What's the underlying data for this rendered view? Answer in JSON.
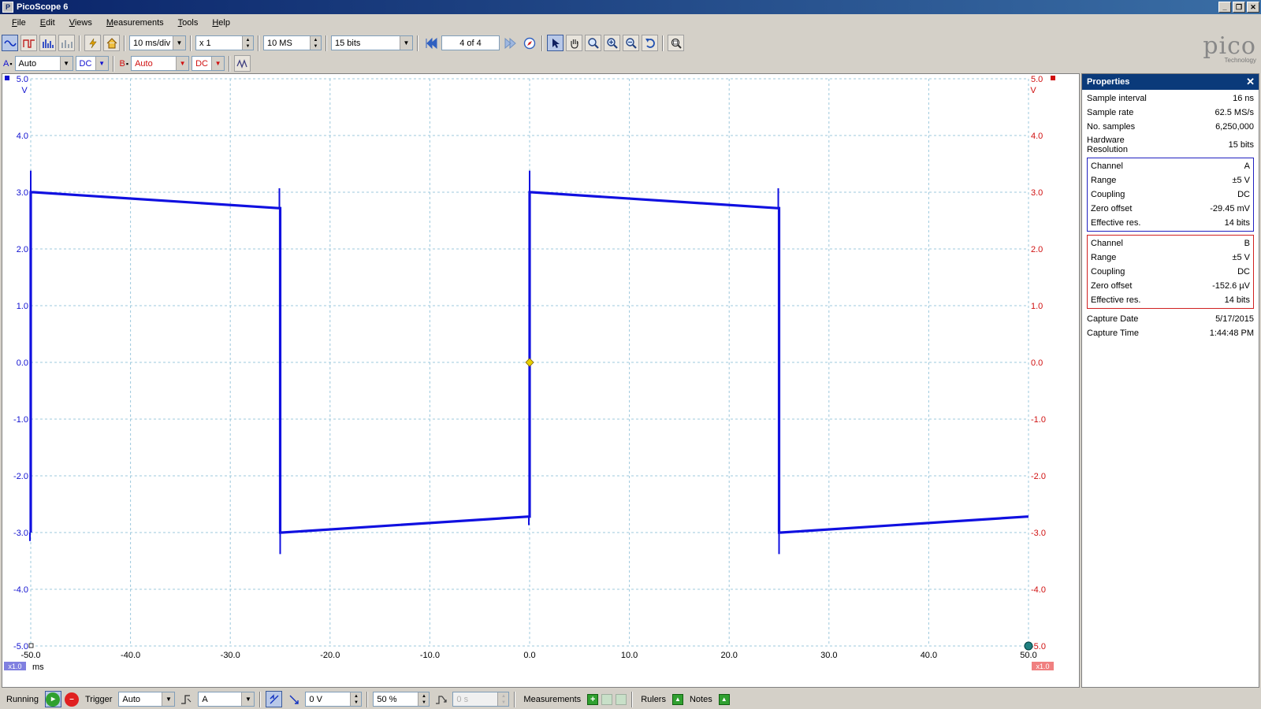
{
  "window": {
    "title": "PicoScope 6"
  },
  "menu": [
    {
      "label": "File",
      "key": "F",
      "rest": "ile"
    },
    {
      "label": "Edit",
      "key": "E",
      "rest": "dit"
    },
    {
      "label": "Views",
      "key": "V",
      "rest": "iews"
    },
    {
      "label": "Measurements",
      "key": "M",
      "rest": "easurements"
    },
    {
      "label": "Tools",
      "key": "T",
      "rest": "ools"
    },
    {
      "label": "Help",
      "key": "H",
      "rest": "elp"
    }
  ],
  "toolbar": {
    "timebase": "10 ms/div",
    "zoom": "x 1",
    "samples": "10 MS",
    "resolution": "15 bits",
    "buffer": "4 of 4"
  },
  "channels": {
    "a": {
      "label": "A",
      "range": "Auto",
      "coupling": "DC",
      "color": "#1010d0"
    },
    "b": {
      "label": "B",
      "range": "Auto",
      "coupling": "DC",
      "color": "#d01010"
    }
  },
  "logo": {
    "main": "pico",
    "sub": "Technology"
  },
  "scope": {
    "x_unit": "ms",
    "left_unit": "V",
    "right_unit": "V",
    "x_ticks": [
      "-50.0",
      "-40.0",
      "-30.0",
      "-20.0",
      "-10.0",
      "0.0",
      "10.0",
      "20.0",
      "30.0",
      "40.0",
      "50.0"
    ],
    "y_ticks": [
      "5.0",
      "4.0",
      "3.0",
      "2.0",
      "1.0",
      "0.0",
      "-1.0",
      "-2.0",
      "-3.0",
      "-4.0",
      "-5.0"
    ],
    "left_scale_badge": "x1.0",
    "right_scale_badge": "x1.0",
    "trigger_color": "#e8d000"
  },
  "chart_data": {
    "type": "line",
    "xlabel": "ms",
    "ylabel": "V",
    "xlim": [
      -50,
      50
    ],
    "ylim": [
      -5,
      5
    ],
    "grid": true,
    "series": [
      {
        "name": "A",
        "color": "#1010e0",
        "x": [
          -50,
          -50,
          -49.7,
          -25.2,
          -25,
          -25,
          -24.8,
          -0.2,
          0,
          0,
          0.2,
          24.8,
          25,
          25,
          25.2,
          49.8,
          50
        ],
        "y": [
          -3.0,
          3.0,
          3.0,
          2.72,
          2.72,
          -3.0,
          -3.0,
          -2.72,
          -2.72,
          3.0,
          3.0,
          2.72,
          2.72,
          -3.0,
          -3.0,
          -2.72,
          -2.72
        ]
      }
    ]
  },
  "properties": {
    "header": "Properties",
    "general": [
      {
        "k": "Sample interval",
        "v": "16 ns"
      },
      {
        "k": "Sample rate",
        "v": "62.5 MS/s"
      },
      {
        "k": "No. samples",
        "v": "6,250,000"
      },
      {
        "k": "Hardware Resolution",
        "v": "15 bits"
      }
    ],
    "channel_a": [
      {
        "k": "Channel",
        "v": "A"
      },
      {
        "k": "Range",
        "v": "±5 V"
      },
      {
        "k": "Coupling",
        "v": "DC"
      },
      {
        "k": "Zero offset",
        "v": "-29.45 mV"
      },
      {
        "k": "Effective res.",
        "v": "14 bits"
      }
    ],
    "channel_b": [
      {
        "k": "Channel",
        "v": "B"
      },
      {
        "k": "Range",
        "v": "±5 V"
      },
      {
        "k": "Coupling",
        "v": "DC"
      },
      {
        "k": "Zero offset",
        "v": "-152.6 µV"
      },
      {
        "k": "Effective res.",
        "v": "14 bits"
      }
    ],
    "capture": [
      {
        "k": "Capture Date",
        "v": "5/17/2015"
      },
      {
        "k": "Capture Time",
        "v": "1:44:48 PM"
      }
    ]
  },
  "status": {
    "running": "Running",
    "trigger_label": "Trigger",
    "trigger_mode": "Auto",
    "trigger_source": "A",
    "trigger_level": "0 V",
    "pre_trigger": "50 %",
    "delay": "0 s",
    "measurements": "Measurements",
    "rulers": "Rulers",
    "notes": "Notes"
  }
}
